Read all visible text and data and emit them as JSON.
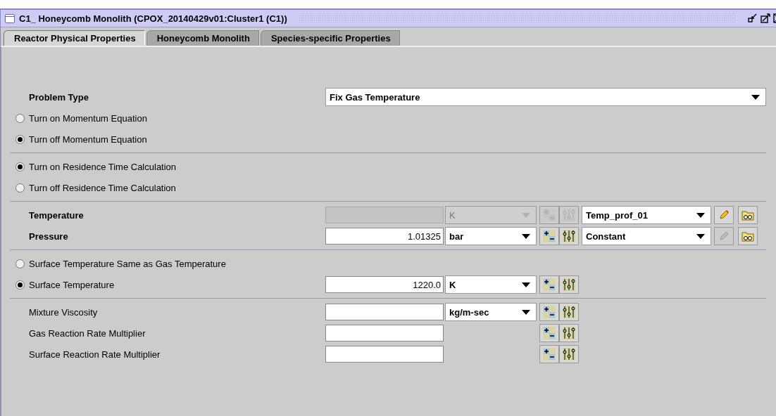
{
  "window": {
    "title": "C1_ Honeycomb Monolith  (CPOX_20140429v01:Cluster1 (C1))"
  },
  "tabs": [
    {
      "label": "Reactor Physical Properties",
      "selected": true
    },
    {
      "label": "Honeycomb Monolith",
      "selected": false
    },
    {
      "label": "Species-specific Properties",
      "selected": false
    }
  ],
  "sections": [
    {
      "rows": [
        {
          "kind": "select",
          "label": "Problem Type",
          "value": "Fix Gas Temperature"
        },
        {
          "kind": "radio",
          "label": "Turn on Momentum Equation",
          "selected": false
        },
        {
          "kind": "radio",
          "label": "Turn off Momentum Equation",
          "selected": true
        }
      ]
    },
    {
      "rows": [
        {
          "kind": "radio",
          "label": "Turn on Residence Time Calculation",
          "selected": true
        },
        {
          "kind": "radio",
          "label": "Turn off Residence Time Calculation",
          "selected": false
        }
      ]
    },
    {
      "rows": [
        {
          "kind": "property",
          "label": "Temperature",
          "bold": true,
          "disabled": true,
          "unit": "K",
          "profile": "Temp_prof_01",
          "edit_disabled": false
        },
        {
          "kind": "property",
          "label": "Pressure",
          "bold": true,
          "disabled": false,
          "value": "1.01325",
          "unit": "bar",
          "profile": "Constant",
          "edit_disabled": true
        }
      ]
    },
    {
      "rows": [
        {
          "kind": "radio",
          "label": "Surface Temperature Same as Gas Temperature",
          "selected": false
        },
        {
          "kind": "radio_property",
          "label": "Surface Temperature",
          "selected": true,
          "value": "1220.0",
          "unit": "K"
        }
      ]
    },
    {
      "rows": [
        {
          "kind": "property",
          "label": "Mixture Viscosity",
          "bold": false,
          "unit": "kg/m-sec"
        },
        {
          "kind": "property",
          "label": "Gas Reaction Rate Multiplier",
          "bold": false
        },
        {
          "kind": "property",
          "label": "Surface Reaction Rate Multiplier",
          "bold": false
        }
      ]
    }
  ]
}
